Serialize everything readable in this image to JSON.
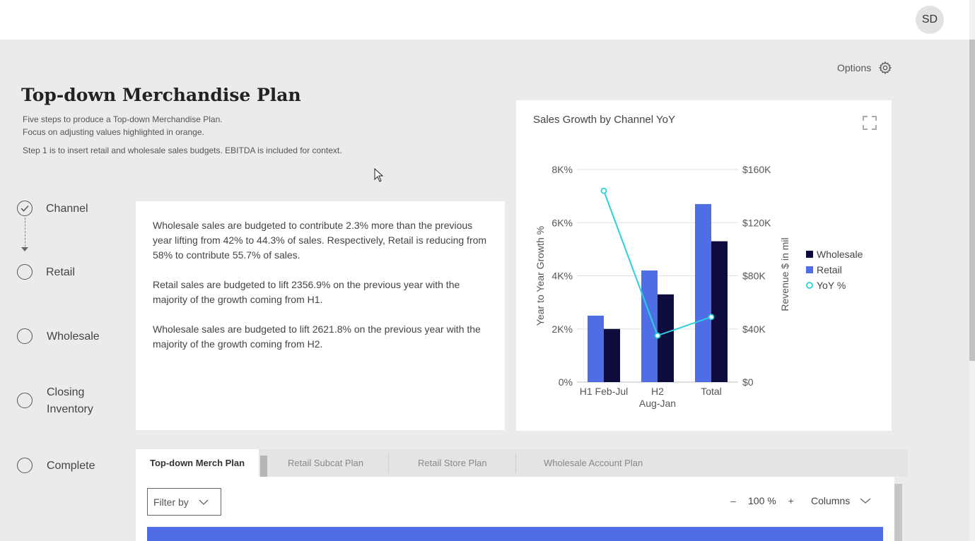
{
  "user": {
    "initials": "SD"
  },
  "options": {
    "label": "Options",
    "icon": "gear-icon"
  },
  "page": {
    "title": "Top-down Merchandise Plan",
    "subtitle_line1": "Five steps to produce a Top-down Merchandise Plan.",
    "subtitle_line2": "Focus on adjusting values highlighted in orange.",
    "step_note": "Step 1 is to insert retail and wholesale sales budgets. EBITDA is included for context."
  },
  "steps": [
    {
      "label": "Channel",
      "state": "complete"
    },
    {
      "label": "Retail",
      "state": "pending"
    },
    {
      "label": "Wholesale",
      "state": "pending"
    },
    {
      "label": "Closing",
      "label2": "Inventory",
      "state": "pending"
    },
    {
      "label": "Complete",
      "state": "pending"
    }
  ],
  "summary": {
    "p1": "Wholesale sales are budgeted to contribute 2.3% more than the previous year lifting from 42% to 44.3% of sales. Respectively, Retail is reducing from 58% to contribute 55.7% of sales.",
    "p2": "Retail sales are budgeted to lift 2356.9% on the previous year with the majority of the growth coming from H1.",
    "p3": "Wholesale sales are budgeted to lift 2621.8% on the previous year with the majority of the growth coming from H2."
  },
  "chart_data": {
    "type": "bar",
    "title": "Sales Growth by Channel YoY",
    "categories": [
      "H1 Feb-Jul",
      "H2\nAug-Jan",
      "Total"
    ],
    "ylabel_left": "Year to Year Growth %",
    "ylabel_right": "Revenue $ in mil",
    "y_left_ticks": [
      "0%",
      "2K%",
      "4K%",
      "6K%",
      "8K%"
    ],
    "y_left_range": [
      0,
      8000
    ],
    "y_right_ticks": [
      "$0",
      "$40K",
      "$80K",
      "$120K",
      "$160K"
    ],
    "y_right_range": [
      0,
      160000
    ],
    "legend_position": "right",
    "grid": true,
    "series": [
      {
        "name": "Retail",
        "axis": "right",
        "kind": "bar",
        "color": "#4f6ee6",
        "values": [
          50000,
          84000,
          134000
        ]
      },
      {
        "name": "Wholesale",
        "axis": "right",
        "kind": "bar",
        "color": "#0e0c3c",
        "values": [
          40000,
          66000,
          106000
        ]
      },
      {
        "name": "YoY %",
        "axis": "left",
        "kind": "line",
        "color": "#2bd0dc",
        "values": [
          7200,
          1750,
          2450
        ]
      }
    ],
    "legend": [
      "Wholesale",
      "Retail",
      "YoY %"
    ]
  },
  "tabs": [
    {
      "label": "Top-down Merch Plan",
      "active": true
    },
    {
      "label": "Retail Subcat Plan",
      "active": false
    },
    {
      "label": "Retail Store Plan",
      "active": false
    },
    {
      "label": "Wholesale Account Plan",
      "active": false
    }
  ],
  "toolbar": {
    "filter_label": "Filter by",
    "zoom_minus": "–",
    "zoom_value": "100 %",
    "zoom_plus": "+",
    "columns_label": "Columns"
  },
  "colors": {
    "accent": "#4f6ee6",
    "dark": "#0e0c3c",
    "line": "#2bd0dc"
  }
}
